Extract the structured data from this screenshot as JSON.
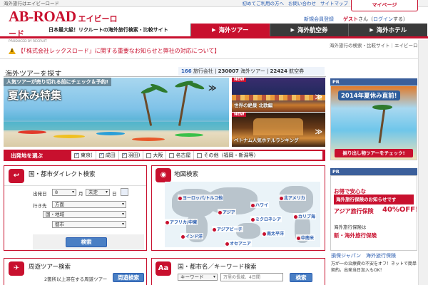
{
  "top_strip": {
    "tag": "海外旅行はエイビーロード",
    "links": [
      "初めてご利用の方へ",
      "お問い合わせ",
      "サイトマップ"
    ]
  },
  "logo": {
    "main": "AB-ROAD",
    "kana": "エイビーロード",
    "byline": "PRODUCED BY RECRUIT",
    "tagline": "日本最大級！リクルートの海外旅行検索・比較サイト"
  },
  "account": {
    "register": "新規会員登録",
    "guest": "ゲスト",
    "guest_suffix": "さん（",
    "login": "ログイン",
    "guest_end": "する）",
    "mypage": "マイページ"
  },
  "nav": {
    "tabs": [
      {
        "label": "海外ツアー",
        "active": true
      },
      {
        "label": "海外航空券",
        "active": false
      },
      {
        "label": "海外ホテル",
        "active": false
      }
    ]
  },
  "breadcrumb": "海外旅行の検索・比較サイト｜エイビーロード",
  "notice": "【「株式会社レックスロード」に関する重要なお知らせと弊社の対応について】",
  "section": {
    "title": "海外ツアーを探す",
    "stats": {
      "companies": "166",
      "companies_label": "旅行会社",
      "tours": "230007",
      "tours_label": "海外ツアー",
      "flights": "22424",
      "flights_label": "航空券"
    }
  },
  "hero": {
    "top": "人気ツアーが売り切れる前にチェック＆予約!",
    "title": "夏休み特集",
    "arrow": "≫"
  },
  "side_banners": [
    {
      "label": "世界の絶景 北欧編",
      "flag": "NEW",
      "arrow": "≫"
    },
    {
      "label": "ベトナム人気ホテルランキング",
      "flag": "NEW",
      "arrow": "≫"
    }
  ],
  "departure": {
    "label": "出発地を選ぶ",
    "options": [
      {
        "label": "東京(",
        "checked": true
      },
      {
        "label": "成田",
        "checked": true
      },
      {
        "label": "羽田)",
        "checked": true
      },
      {
        "label": "大阪",
        "checked": false
      },
      {
        "label": "名古屋",
        "checked": false
      },
      {
        "label": "その他（福岡・新潟等）",
        "checked": false
      }
    ]
  },
  "direct_search": {
    "title": "国・都市ダイレクト検索",
    "date_label": "出発日",
    "month": "8",
    "month_unit": "月",
    "day": "未定",
    "day_unit": "日",
    "dest_label": "行き先",
    "region": "方面",
    "country": "国・地域",
    "city": "都市",
    "button": "検索"
  },
  "map_search": {
    "title": "地図検索",
    "labels": [
      "ヨーロッパ/トルコ他",
      "北アメリカ",
      "ハワイ",
      "アジア",
      "アフリカ/中東",
      "ミクロネシア",
      "カリブ海",
      "インド洋",
      "アジアビーチ",
      "南太平洋",
      "中南米",
      "オセアニア"
    ]
  },
  "circulation": {
    "title": "周遊ツアー検索",
    "desc": "2箇所以上滞在する周遊ツアー",
    "button": "周遊検索"
  },
  "keyword": {
    "title": "国・都市名／キーワード検索",
    "select": "キーワード",
    "placeholder": "万里の長城、4日間",
    "button": "検索"
  },
  "sidebar": {
    "pr1": "PR",
    "ban1_title": "2014年夏休み直前!",
    "ban1_bottom": "掘り出し物ツアーをチェック!",
    "pr2": "PR",
    "ban2_lines": [
      "お得で安心な",
      "海外旅行保険のお知らせです",
      "アジア旅行保険",
      "40%OFF!",
      "海外旅行保険は",
      "新・海外旅行保険"
    ],
    "link": "損保ジャパン　海外旅行保険",
    "text": "万が一の治療費の不安をオフ！ネットで簡単契約。出発当日加入もOK！"
  },
  "colors": {
    "brand": "#c8102e",
    "link": "#2a5db0",
    "nav_dark": "#3a3a3a",
    "pr": "#3b5f9b"
  }
}
